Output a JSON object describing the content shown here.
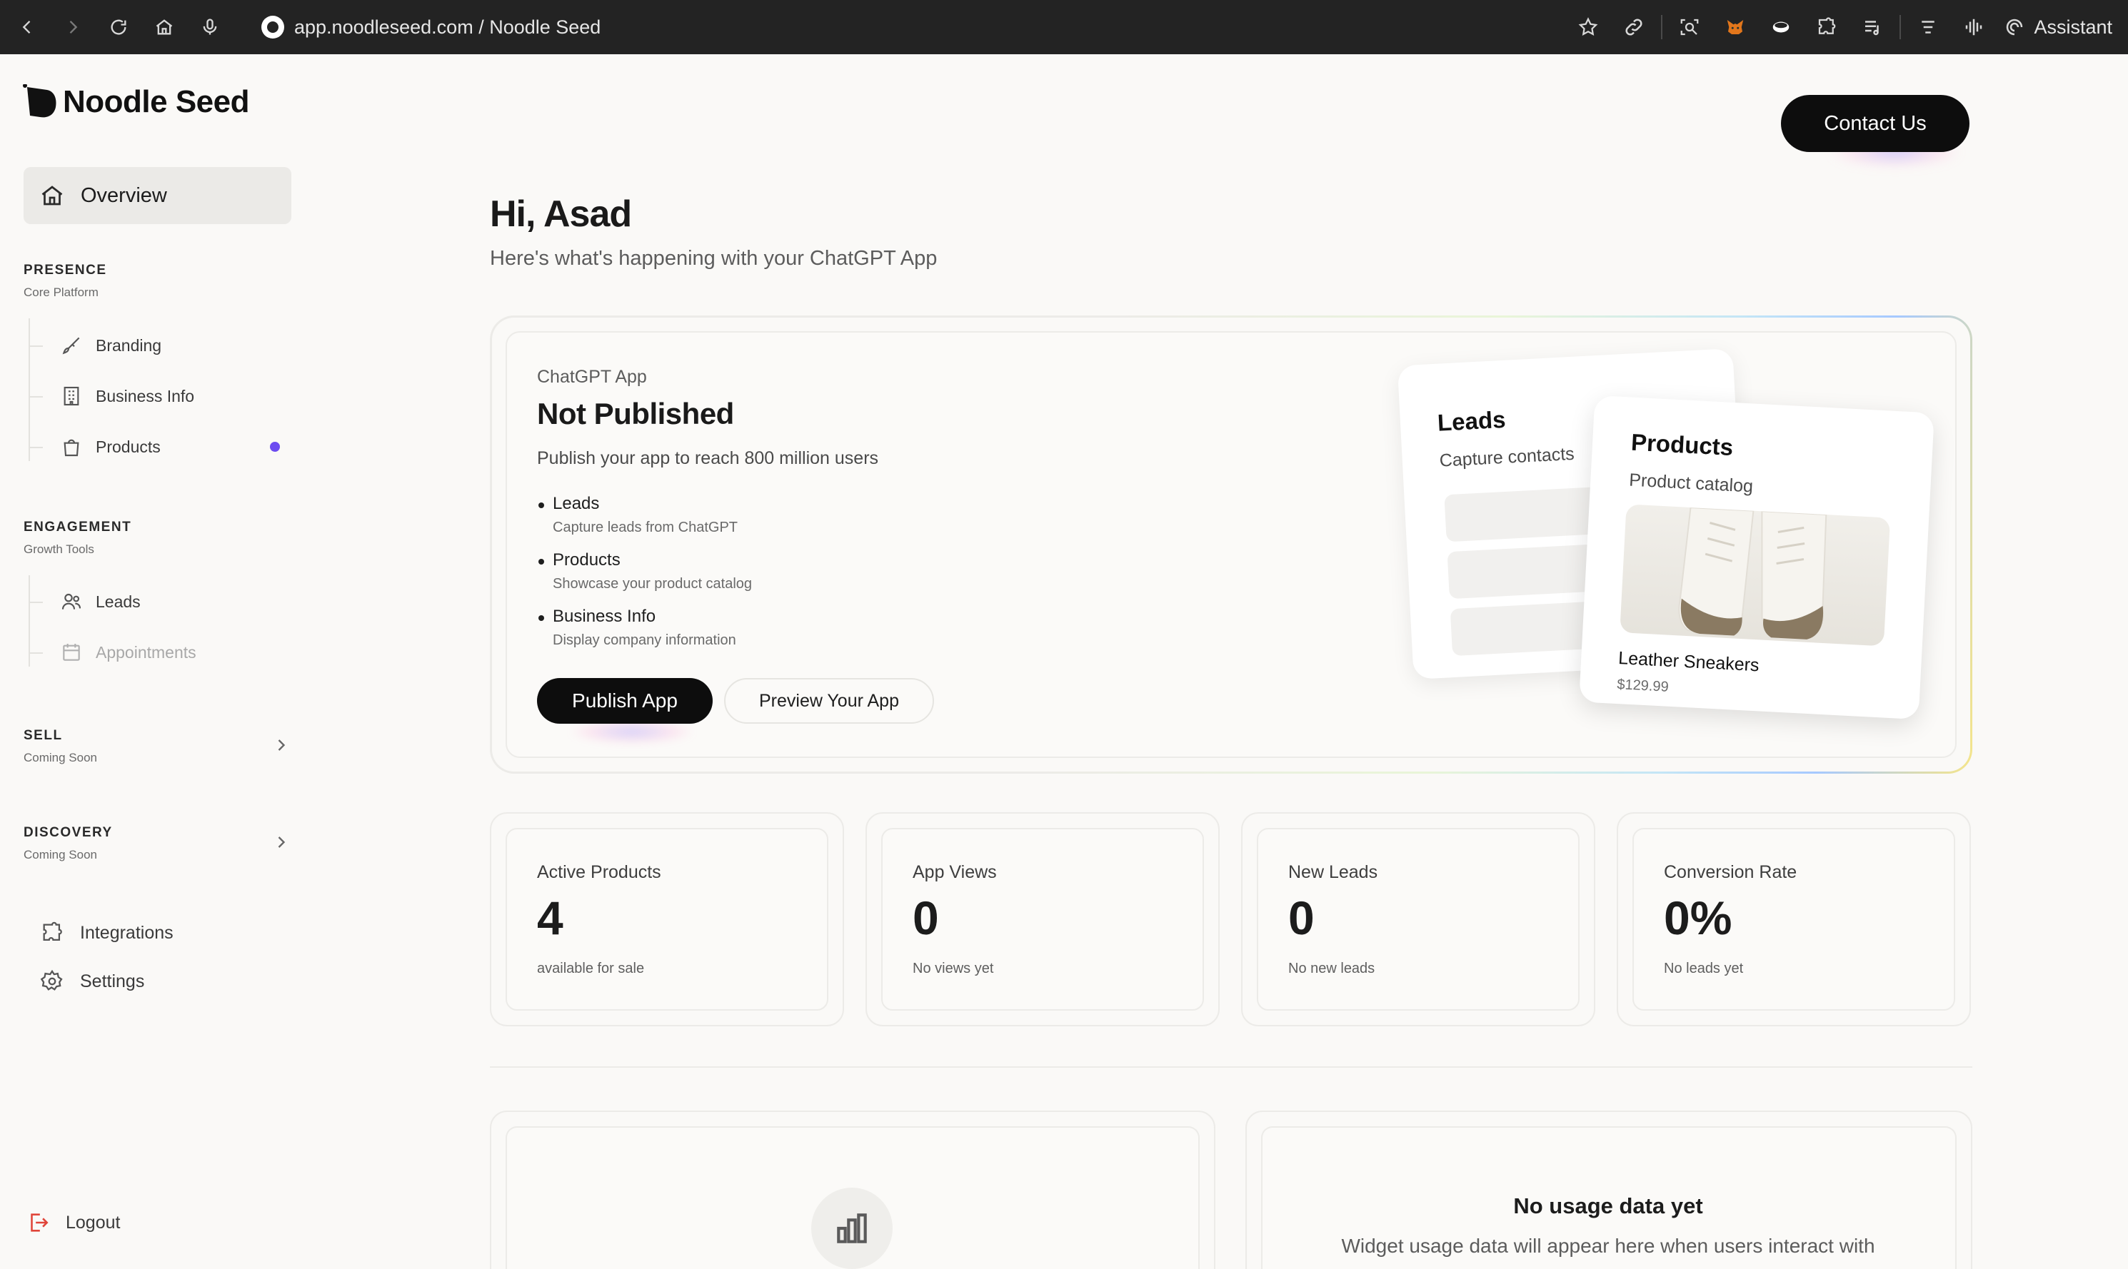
{
  "browser": {
    "url": "app.noodleseed.com / Noodle Seed",
    "assistant_label": "Assistant"
  },
  "sidebar": {
    "logo_text": "Noodle Seed",
    "overview_label": "Overview",
    "presence": {
      "title": "PRESENCE",
      "subtitle": "Core Platform",
      "items": [
        {
          "label": "Branding"
        },
        {
          "label": "Business Info"
        },
        {
          "label": "Products"
        }
      ]
    },
    "engagement": {
      "title": "ENGAGEMENT",
      "subtitle": "Growth Tools",
      "items": [
        {
          "label": "Leads"
        },
        {
          "label": "Appointments"
        }
      ]
    },
    "sell": {
      "title": "SELL",
      "subtitle": "Coming Soon"
    },
    "discovery": {
      "title": "DISCOVERY",
      "subtitle": "Coming Soon"
    },
    "integrations_label": "Integrations",
    "settings_label": "Settings",
    "logout_label": "Logout"
  },
  "header": {
    "contact_label": "Contact Us",
    "greeting": "Hi, Asad",
    "subtitle": "Here's what's happening with your ChatGPT App"
  },
  "hero": {
    "label": "ChatGPT App",
    "status": "Not Published",
    "description": "Publish your app to reach 800 million users",
    "features": [
      {
        "title": "Leads",
        "desc": "Capture leads from ChatGPT"
      },
      {
        "title": "Products",
        "desc": "Showcase your product catalog"
      },
      {
        "title": "Business Info",
        "desc": "Display company information"
      }
    ],
    "publish_label": "Publish App",
    "preview_label": "Preview Your App",
    "leads_card": {
      "title": "Leads",
      "subtitle": "Capture contacts"
    },
    "products_card": {
      "title": "Products",
      "subtitle": "Product catalog",
      "item_name": "Leather Sneakers",
      "item_price": "$129.99"
    }
  },
  "stats": [
    {
      "label": "Active Products",
      "value": "4",
      "sub": "available for sale"
    },
    {
      "label": "App Views",
      "value": "0",
      "sub": "No views yet"
    },
    {
      "label": "New Leads",
      "value": "0",
      "sub": "No new leads"
    },
    {
      "label": "Conversion Rate",
      "value": "0%",
      "sub": "No leads yet"
    }
  ],
  "usage": {
    "title": "No usage data yet",
    "subtitle": "Widget usage data will appear here when users interact with"
  },
  "colors": {
    "accent_dot": "#6c4cf0",
    "logout_icon": "#e0453a"
  }
}
